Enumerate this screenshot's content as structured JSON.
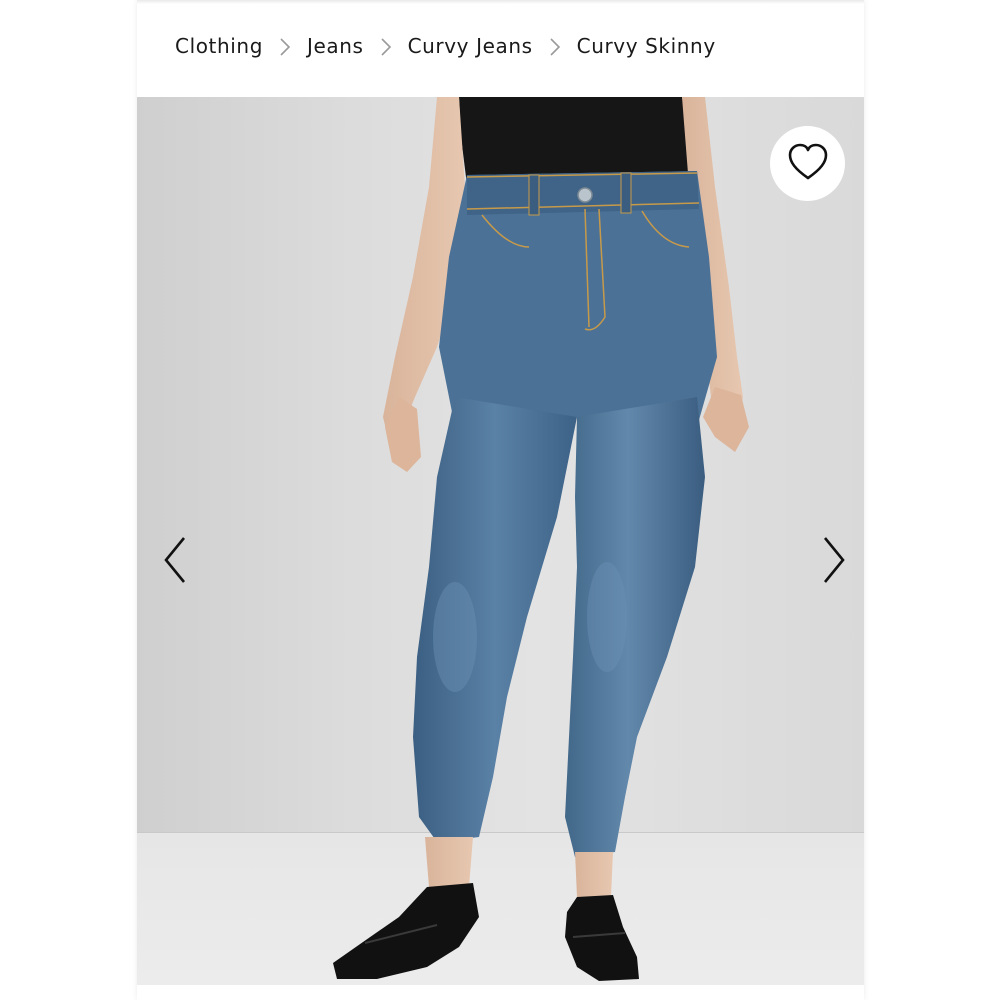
{
  "breadcrumb": {
    "items": [
      {
        "label": "Clothing"
      },
      {
        "label": "Jeans"
      },
      {
        "label": "Curvy Jeans"
      },
      {
        "label": "Curvy Skinny"
      }
    ],
    "separator_icon": "chevron-right-icon"
  },
  "gallery": {
    "image_subject": "model wearing medium-wash high-rise skinny jeans, black top, black penny loafers",
    "favorite_icon": "heart-outline-icon",
    "prev_icon": "chevron-left-icon",
    "next_icon": "chevron-right-icon"
  },
  "colors": {
    "text": "#1a1a1a",
    "separator": "#9a9a9a",
    "denim": "#4a6f93",
    "background": "#dcdcdc"
  }
}
